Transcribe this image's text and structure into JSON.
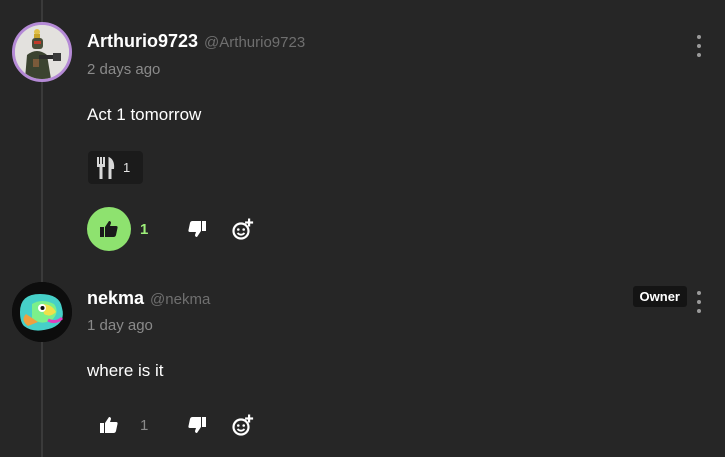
{
  "comments": [
    {
      "username": "Arthurio9723",
      "handle": "@Arthurio9723",
      "timestamp": "2 days ago",
      "body": "Act 1 tomorrow",
      "reaction": {
        "icon": "fork-knife-icon",
        "count": "1"
      },
      "likes": "1",
      "liked": true,
      "avatar": "soldier-avatar"
    },
    {
      "username": "nekma",
      "handle": "@nekma",
      "timestamp": "1 day ago",
      "body": "where is it",
      "badge": "Owner",
      "likes": "1",
      "liked": false,
      "avatar": "rainbow-duck-avatar"
    }
  ],
  "colors": {
    "background": "#262626",
    "like_active": "#8ee26f",
    "avatar_ring": "#b58ad6"
  }
}
